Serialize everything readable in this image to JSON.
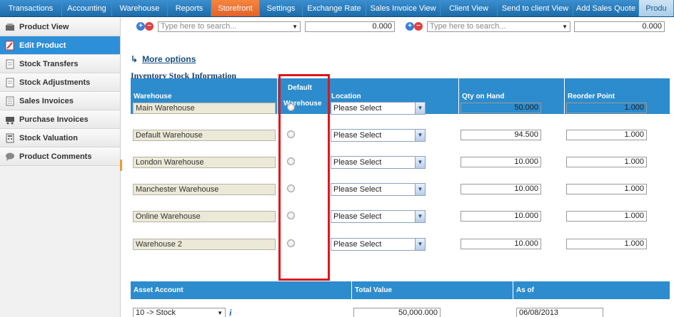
{
  "tabs": [
    {
      "label": "Transactions",
      "w": 87
    },
    {
      "label": "Accounting",
      "w": 70
    },
    {
      "label": "Warehouse",
      "w": 78
    },
    {
      "label": "Reports",
      "w": 61
    },
    {
      "label": "Storefront",
      "w": 68
    },
    {
      "label": "Settings",
      "w": 60
    },
    {
      "label": "Exchange Rate",
      "w": 89
    },
    {
      "label": "Sales Invoice View",
      "w": 104
    },
    {
      "label": "Client View",
      "w": 80
    },
    {
      "label": "Send to client View",
      "w": 106
    },
    {
      "label": "Add Sales Quote",
      "w": 92
    },
    {
      "label": "Produ",
      "w": 49
    }
  ],
  "sidebar": {
    "items": [
      {
        "label": "Product View",
        "icon": "product-view-icon"
      },
      {
        "label": "Edit Product",
        "icon": "edit-icon"
      },
      {
        "label": "Stock Transfers",
        "icon": "document-icon"
      },
      {
        "label": "Stock Adjustments",
        "icon": "document-icon"
      },
      {
        "label": "Sales Invoices",
        "icon": "invoice-icon"
      },
      {
        "label": "Purchase Invoices",
        "icon": "cart-icon"
      },
      {
        "label": "Stock Valuation",
        "icon": "calculator-icon"
      },
      {
        "label": "Product Comments",
        "icon": "comment-icon"
      }
    ]
  },
  "search": {
    "left_placeholder": "Type here to search...",
    "left_value": "0.000",
    "right_placeholder": "Type here to search...",
    "right_value": "0.000"
  },
  "more_options": "More options",
  "section_title": "Inventory Stock Information",
  "table": {
    "headers": {
      "warehouse": "Warehouse",
      "default_line1": "Default",
      "default_line2": "Warehouse",
      "location": "Location",
      "qty": "Qty on Hand",
      "reorder": "Reorder Point"
    },
    "rows": [
      {
        "warehouse": "Main Warehouse",
        "location": "Please Select",
        "qty": "50.000",
        "reorder": "1.000"
      },
      {
        "warehouse": "Default Warehouse",
        "location": "Please Select",
        "qty": "94.500",
        "reorder": "1.000"
      },
      {
        "warehouse": "London Warehouse",
        "location": "Please Select",
        "qty": "10.000",
        "reorder": "1.000"
      },
      {
        "warehouse": "Manchester Warehouse",
        "location": "Please Select",
        "qty": "10.000",
        "reorder": "1.000"
      },
      {
        "warehouse": "Online Warehouse",
        "location": "Please Select",
        "qty": "10.000",
        "reorder": "1.000"
      },
      {
        "warehouse": "Warehouse 2",
        "location": "Please Select",
        "qty": "10.000",
        "reorder": "1.000"
      }
    ]
  },
  "asset": {
    "headers": {
      "account": "Asset Account",
      "total": "Total Value",
      "asof": "As of"
    },
    "account": "10 -> Stock",
    "total": "50,000.000",
    "asof": "06/08/2013"
  },
  "colors": {
    "tab_active": "#e0622a",
    "header_blue": "#2c8ccd",
    "highlight_red": "#e0161c"
  }
}
